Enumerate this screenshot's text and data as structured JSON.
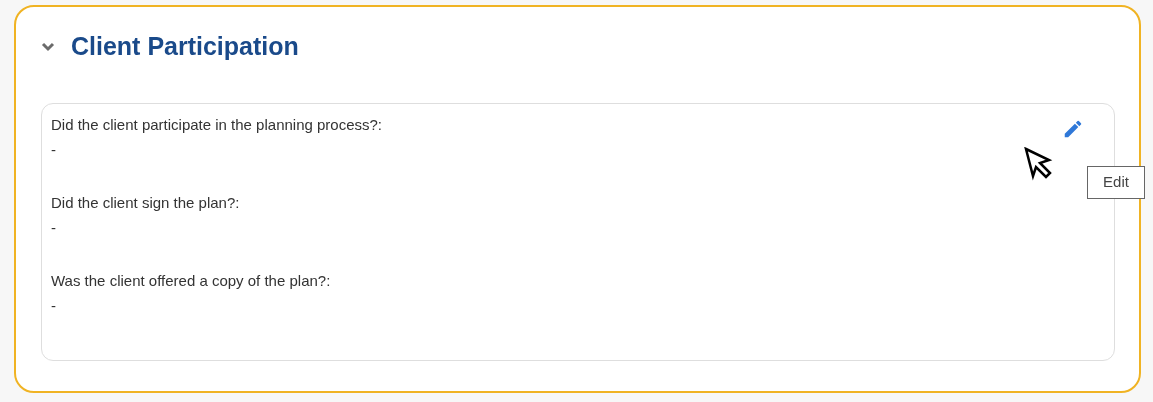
{
  "section": {
    "title": "Client Participation",
    "expanded": true
  },
  "fields": [
    {
      "label": "Did the client participate in the planning process?:",
      "value": "-"
    },
    {
      "label": "Did the client sign the plan?:",
      "value": "-"
    },
    {
      "label": "Was the client offered a copy of the plan?:",
      "value": "-"
    }
  ],
  "tooltip": {
    "text": "Edit"
  }
}
